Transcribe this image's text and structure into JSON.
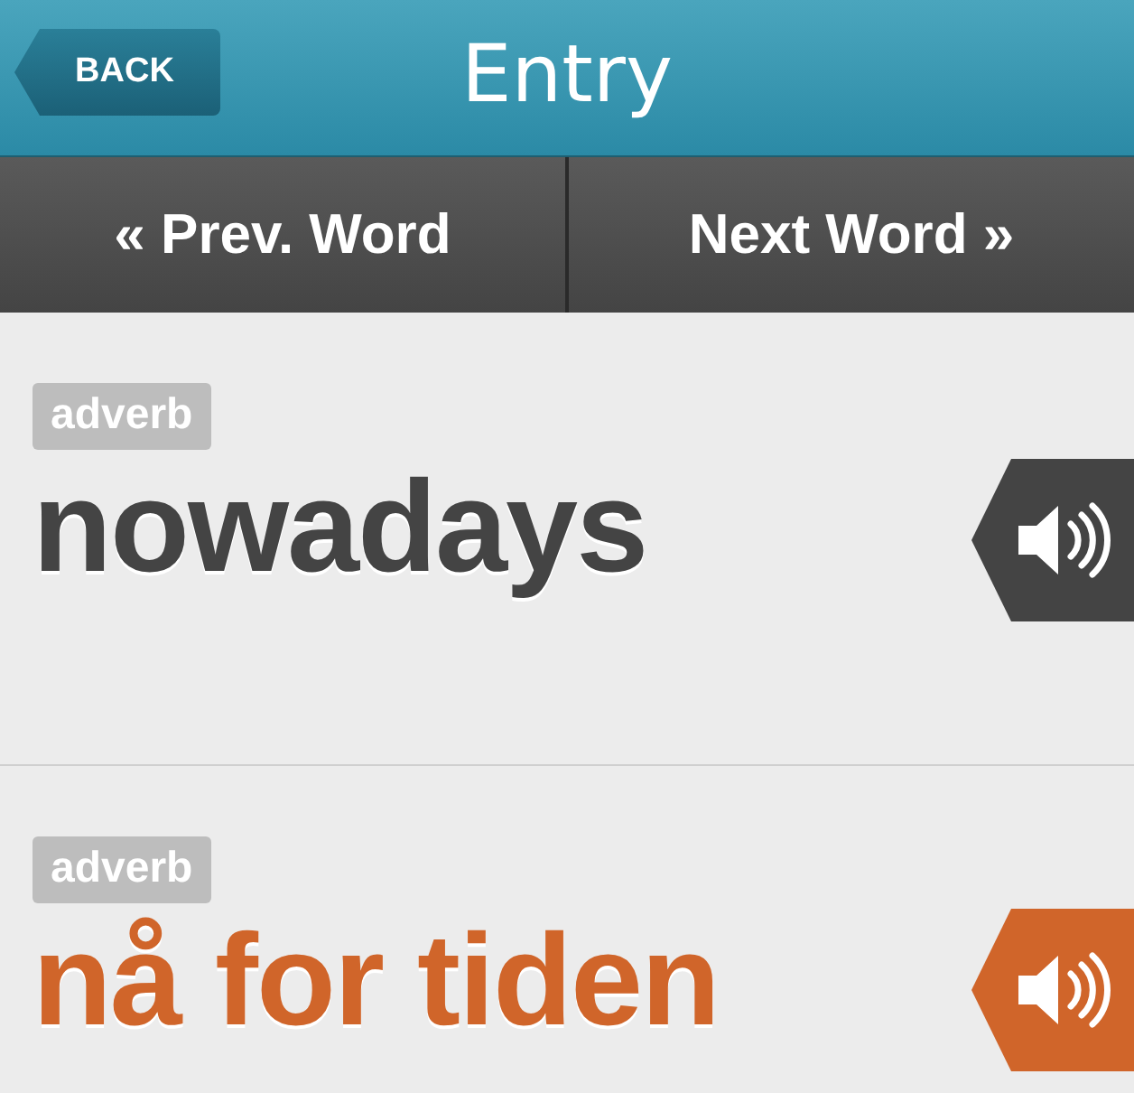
{
  "header": {
    "title": "Entry",
    "back_button": "BACK"
  },
  "nav": [
    {
      "label": "« Prev. Word"
    },
    {
      "label": "Next Word »"
    }
  ],
  "entries": [
    {
      "part_of_speech": "adverb",
      "word": "nowadays",
      "color": "#444444"
    },
    {
      "part_of_speech": "adverb",
      "word": "nå for tiden",
      "color": "#d0652a"
    }
  ]
}
